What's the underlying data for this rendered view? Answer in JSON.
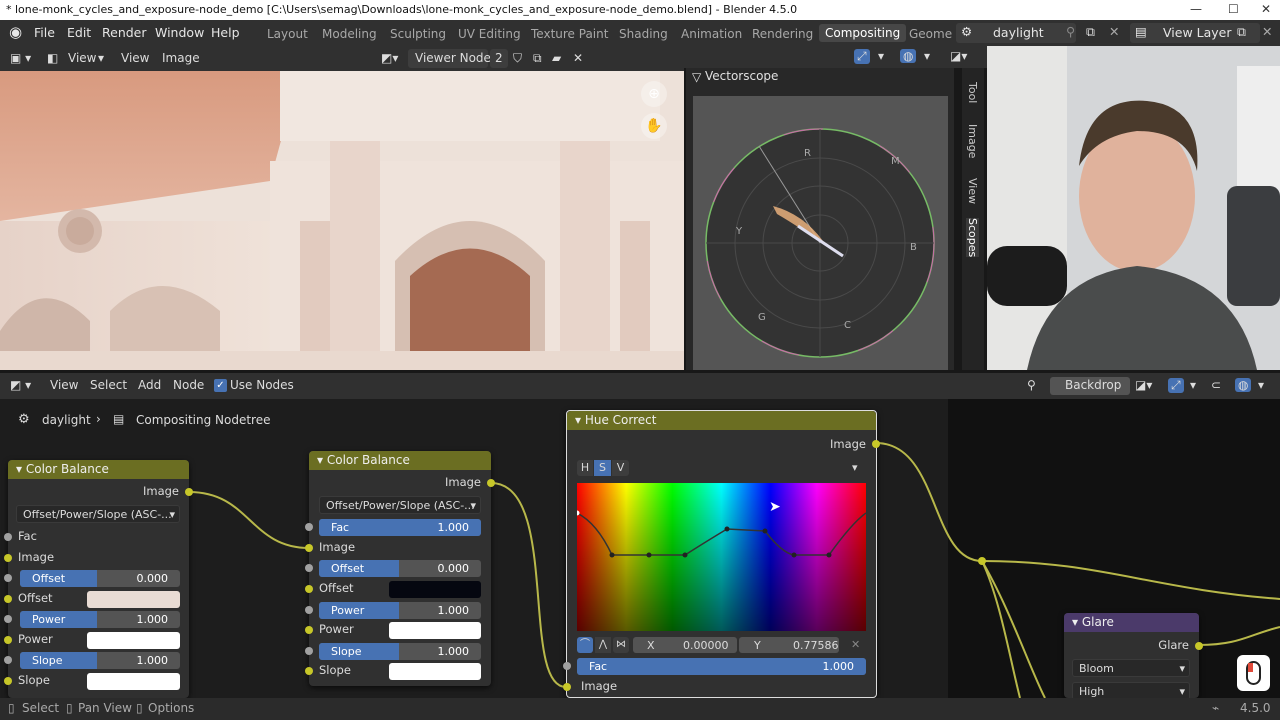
{
  "titlebar": {
    "title": "* lone-monk_cycles_and_exposure-node_demo [C:\\Users\\semag\\Downloads\\lone-monk_cycles_and_exposure-node_demo.blend] - Blender 4.5.0",
    "min": "—",
    "max": "☐",
    "close": "✕"
  },
  "menu": {
    "items": [
      "File",
      "Edit",
      "Render",
      "Window",
      "Help"
    ]
  },
  "workspaces": [
    "Layout",
    "Modeling",
    "Sculpting",
    "UV Editing",
    "Texture Paint",
    "Shading",
    "Animation",
    "Rendering",
    "Compositing",
    "Geome"
  ],
  "scene": {
    "name": "daylight",
    "view_layer": "View Layer"
  },
  "image_editor": {
    "menus": [
      "View",
      "View",
      "Image"
    ],
    "viewer": "Viewer Node",
    "users": "2"
  },
  "scopes": {
    "title": "Vectorscope",
    "labels": [
      "R",
      "M",
      "B",
      "C",
      "G",
      "Y"
    ]
  },
  "sidebar_tabs": [
    "Tool",
    "Image",
    "View",
    "Scopes"
  ],
  "node_header": {
    "menus": [
      "View",
      "Select",
      "Add",
      "Node"
    ],
    "use_nodes": "Use Nodes",
    "backdrop": "Backdrop"
  },
  "breadcrumb": {
    "scene": "daylight",
    "tree": "Compositing Nodetree"
  },
  "nodes": {
    "cb1": {
      "title": "Color Balance",
      "out": "Image",
      "mode": "Offset/Power/Slope (ASC-...",
      "fac": "Fac",
      "image": "Image",
      "offset": "Offset",
      "offset_val": "0.000",
      "power": "Power",
      "power_val": "1.000",
      "slope": "Slope",
      "slope_val": "1.000"
    },
    "cb2": {
      "title": "Color Balance",
      "out": "Image",
      "mode": "Offset/Power/Slope (ASC-...",
      "fac": "Fac",
      "fac_val": "1.000",
      "image": "Image",
      "offset": "Offset",
      "offset_val": "0.000",
      "power": "Power",
      "power_val": "1.000",
      "slope": "Slope",
      "slope_val": "1.000"
    },
    "hue": {
      "title": "Hue Correct",
      "out": "Image",
      "tabs": [
        "H",
        "S",
        "V"
      ],
      "x_label": "X",
      "x_val": "0.00000",
      "y_label": "Y",
      "y_val": "0.77586",
      "fac": "Fac",
      "fac_val": "1.000",
      "image": "Image"
    },
    "glare": {
      "title": "Glare",
      "out": "Glare",
      "type": "Bloom",
      "quality": "High"
    }
  },
  "status": {
    "select": "Select",
    "pan": "Pan View",
    "options": "Options",
    "version": "4.5.0"
  },
  "colors": {
    "accent": "#4772b3",
    "node_header": "#6b6e22",
    "glare_header": "#4b3a6a",
    "socket": "#c7c729"
  }
}
